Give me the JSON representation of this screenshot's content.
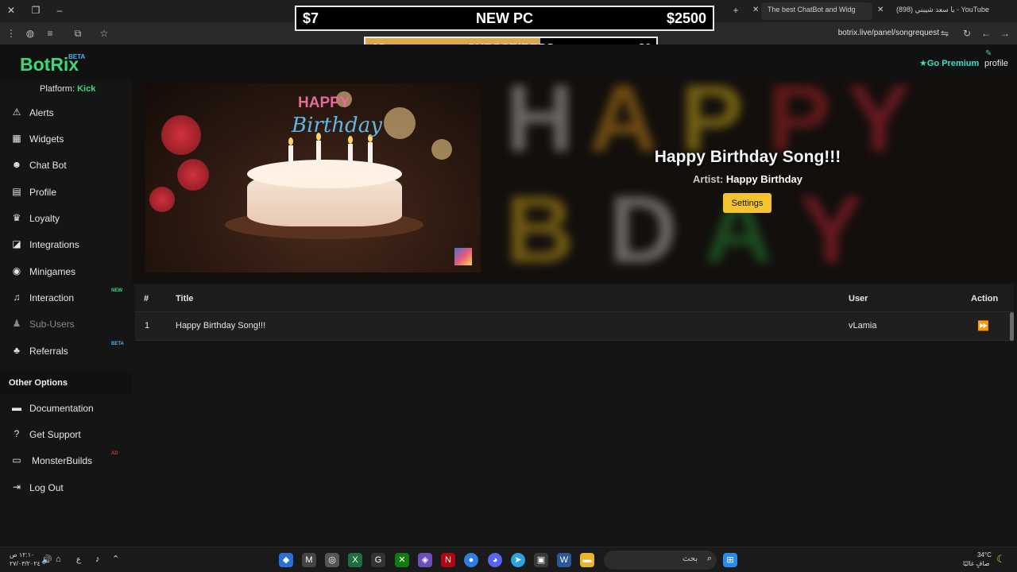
{
  "browser": {
    "tabs": [
      {
        "label": "The best ChatBot and Widg"
      },
      {
        "label": "(898) يا سعد شيبني - YouTube"
      }
    ],
    "url": "botrix.live/panel/songrequest"
  },
  "goal_widget": {
    "left": "$7",
    "title": "NEW PC",
    "right": "$2500"
  },
  "subs_widget": {
    "left": "18",
    "title": "SUBSCRIBERS",
    "right": "30",
    "progress": 0.6,
    "color": "#d9a94a"
  },
  "header": {
    "logo": "BotRix",
    "logo_badge": "BETA",
    "premium": "Go Premium",
    "profile": "profile",
    "accent": "#3ed87a"
  },
  "sidebar": {
    "platform_label": "Platform:",
    "platform_value": "Kick",
    "items": [
      {
        "label": "Alerts",
        "icon": "warning-icon"
      },
      {
        "label": "Widgets",
        "icon": "widgets-icon"
      },
      {
        "label": "Chat Bot",
        "icon": "robot-icon"
      },
      {
        "label": "Profile",
        "icon": "profile-card-icon"
      },
      {
        "label": "Loyalty",
        "icon": "trophy-icon"
      },
      {
        "label": "Integrations",
        "icon": "integrations-icon"
      },
      {
        "label": "Minigames",
        "icon": "gamepad-icon"
      },
      {
        "label": "Interaction",
        "icon": "music-note-icon",
        "badge": "NEW"
      },
      {
        "label": "Sub-Users",
        "icon": "users-icon"
      },
      {
        "label": "Referrals",
        "icon": "referrals-icon",
        "badge": "BETA"
      }
    ],
    "other_header": "Other Options",
    "other_items": [
      {
        "label": "Documentation",
        "icon": "scroll-icon"
      },
      {
        "label": "Get Support",
        "icon": "question-icon"
      },
      {
        "label": "MonsterBuilds",
        "icon": "laptop-icon",
        "badge": "AD"
      },
      {
        "label": "Log Out",
        "icon": "logout-icon"
      }
    ]
  },
  "now_playing": {
    "thumb_line1": "HAPPY",
    "thumb_line2": "Birthday",
    "title": "Happy Birthday Song!!!",
    "artist_label": "Artist:",
    "artist": "Happy Birthday",
    "settings_label": "Settings"
  },
  "queue": {
    "columns": [
      "#",
      "Title",
      "User",
      "Action"
    ],
    "rows": [
      {
        "num": "1",
        "title": "Happy Birthday Song!!!",
        "user": "vLamia"
      }
    ]
  },
  "taskbar": {
    "search_placeholder": "بحث",
    "weather_temp": "34°C",
    "weather_desc": "صافٍ غالبًا",
    "time": "١٢:١٠ ص",
    "date": "٢٧/٠٣/٢٠٢٤",
    "lang": "ع"
  }
}
